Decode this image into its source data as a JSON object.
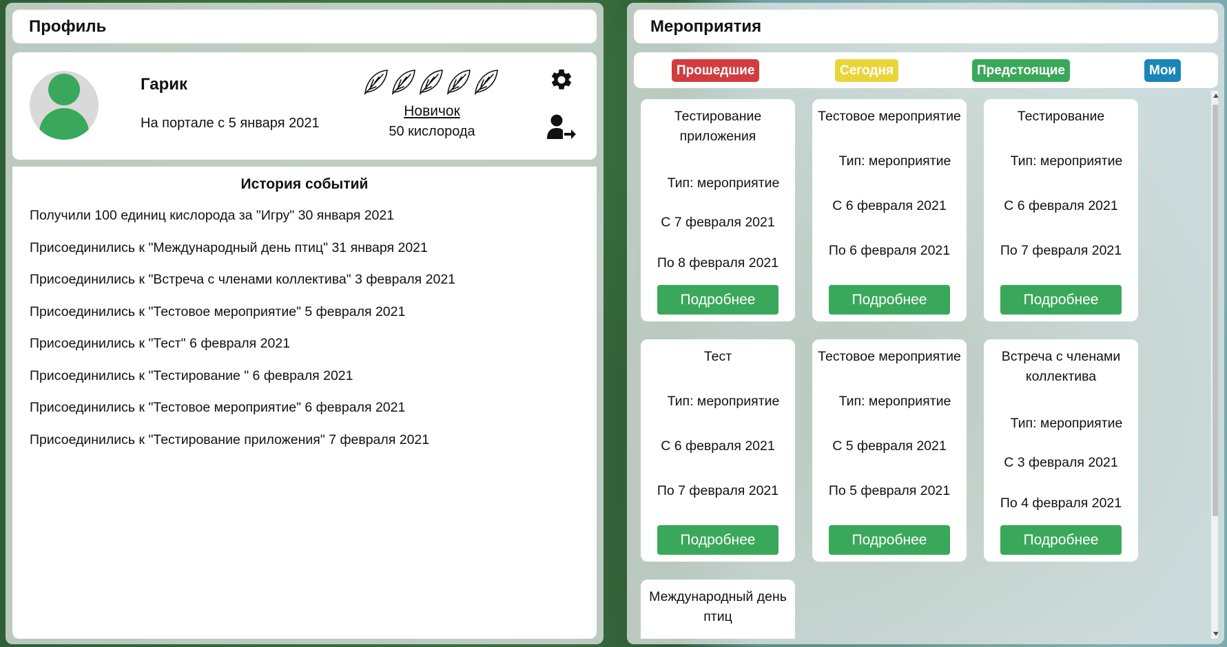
{
  "profile": {
    "header_title": "Профиль",
    "name": "Гарик",
    "since": "На портале с 5 января 2021",
    "rank": "Новичок",
    "oxygen": "50 кислорода",
    "leaf_count": 5,
    "icons": [
      "user-avatar",
      "leaf-icon",
      "gear-icon",
      "user-logout-icon"
    ]
  },
  "history": {
    "title": "История событий",
    "items": [
      "Получили 100 единиц кислорода за \"Игру\" 30 января 2021",
      "Присоединились к \"Международный день птиц\" 31 января 2021",
      "Присоединились к \"Встреча с членами коллектива\" 3 февраля 2021",
      "Присоединились к \"Тестовое мероприятие\" 5 февраля 2021",
      "Присоединились к \"Тест\" 6 февраля 2021",
      "Присоединились к \"Тестирование \" 6 февраля 2021",
      "Присоединились к \"Тестовое мероприятие\" 6 февраля 2021",
      "Присоединились к \"Тестирование приложения\" 7 февраля 2021"
    ]
  },
  "events": {
    "header_title": "Мероприятия",
    "filters": {
      "past": "Прошедшие",
      "today": "Сегодня",
      "upcoming": "Предстоящие",
      "mine": "Мои"
    },
    "more_label": "Подробнее",
    "cards": [
      {
        "title": "Тестирование приложения",
        "type": "Тип: мероприятие",
        "from": "С 7 февраля 2021",
        "to": "По 8 февраля 2021"
      },
      {
        "title": "Тестовое мероприятие",
        "type": "Тип: мероприятие",
        "from": "С 6 февраля 2021",
        "to": "По 6 февраля 2021"
      },
      {
        "title": "Тестирование",
        "type": "Тип: мероприятие",
        "from": "С 6 февраля 2021",
        "to": "По 7 февраля 2021"
      },
      {
        "title": "Тест",
        "type": "Тип: мероприятие",
        "from": "С 6 февраля 2021",
        "to": "По 7 февраля 2021"
      },
      {
        "title": "Тестовое мероприятие",
        "type": "Тип: мероприятие",
        "from": "С 5 февраля 2021",
        "to": "По 5 февраля 2021"
      },
      {
        "title": "Встреча с членами коллектива",
        "type": "Тип: мероприятие",
        "from": "С 3 февраля 2021",
        "to": "По 4 февраля 2021"
      },
      {
        "title": "Международный день птиц"
      }
    ]
  },
  "colors": {
    "past": "#d13d3f",
    "today": "#e9d53a",
    "upcoming": "#3aa85a",
    "mine": "#1a86b8",
    "button": "#3aa85a"
  }
}
